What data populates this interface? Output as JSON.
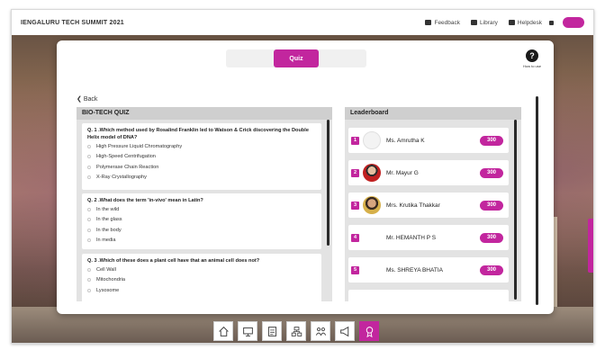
{
  "topbar": {
    "title": "IENGALURU TECH SUMMIT 2021",
    "feedback": "Feedback",
    "library": "Library",
    "helpdesk": "Helpdesk"
  },
  "modal": {
    "tab_label": "Quiz",
    "how_to_use": "How to use",
    "back_label": "Back"
  },
  "quiz": {
    "title": "BIO-TECH QUIZ",
    "questions": [
      {
        "text": "Q. 1 .Which method used by Rosalind Franklin led to Watson & Crick discovering the Double Helix model of DNA?",
        "options": [
          "High Pressure Liquid Chromatography",
          "High-Speed Centrifugation",
          "Polymerase Chain Reaction",
          "X-Ray Crystallography"
        ]
      },
      {
        "text": "Q. 2 .What does the term 'in-vivo' mean in Latin?",
        "options": [
          "In the wild",
          "In the glass",
          "In the body",
          "In media"
        ]
      },
      {
        "text": "Q. 3 .Which of these does a plant cell have that an animal cell does not?",
        "options": [
          "Cell Wall",
          "Mitochondria",
          "Lysosome"
        ]
      }
    ]
  },
  "leaderboard": {
    "title": "Leaderboard",
    "entries": [
      {
        "rank": "1",
        "name": "Ms. Amrutha K",
        "score": "300"
      },
      {
        "rank": "2",
        "name": "Mr. Mayur G",
        "score": "300"
      },
      {
        "rank": "3",
        "name": "Mrs. Krutika Thakkar",
        "score": "300"
      },
      {
        "rank": "4",
        "name": "Mr. HEMANTH P S",
        "score": "300"
      },
      {
        "rank": "5",
        "name": "Ms. SHREYA BHATIA",
        "score": "300"
      }
    ]
  },
  "dock": {
    "icons": [
      "home-icon",
      "monitor-icon",
      "document-icon",
      "network-icon",
      "people-icon",
      "megaphone-icon",
      "award-icon"
    ],
    "active": "award-icon"
  },
  "colors": {
    "accent": "#c2269e",
    "panel": "#e3e3e3"
  }
}
